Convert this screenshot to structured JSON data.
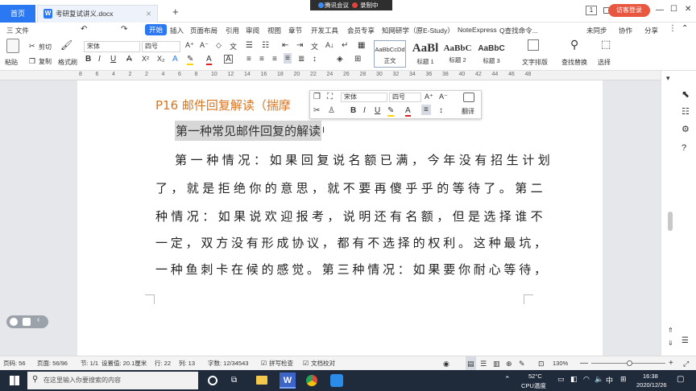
{
  "tabs": {
    "home": "首页",
    "doc_title": "考研复试讲义.docx",
    "add": "+"
  },
  "meeting": {
    "tencent": "腾讯会议",
    "recording": "录制中"
  },
  "window": {
    "page_indicator": "1",
    "login": "访客登录"
  },
  "menu": {
    "file": "三 文件",
    "items": [
      "开始",
      "插入",
      "页面布局",
      "引用",
      "审阅",
      "视图",
      "章节",
      "开发工具",
      "会员专享",
      "知网研学（原E-Study）",
      "NoteExpress",
      "Q查找命令..."
    ],
    "right": [
      "未同步",
      "协作",
      "分享"
    ]
  },
  "ribbon": {
    "paste": "粘贴",
    "cut": "剪切",
    "copy": "复制",
    "format_painter": "格式刷",
    "font": "宋体",
    "size": "四号",
    "styles": [
      {
        "preview": "AaBbCcDd",
        "name": "正文"
      },
      {
        "preview": "AaBl",
        "name": "标题 1"
      },
      {
        "preview": "AaBbC",
        "name": "标题 2"
      },
      {
        "preview": "AaBbC",
        "name": "标题 3"
      }
    ],
    "text_layout": "文字排版",
    "find_replace": "查找替换",
    "select": "选择"
  },
  "ruler": {
    "ticks": [
      "8",
      "6",
      "4",
      "2",
      "2",
      "4",
      "6",
      "8",
      "10",
      "12",
      "14",
      "16",
      "18",
      "20",
      "22",
      "24",
      "26",
      "28",
      "30",
      "32",
      "34",
      "36",
      "38",
      "40",
      "42",
      "44",
      "46",
      "48"
    ]
  },
  "mini_toolbar": {
    "font": "宋体",
    "size": "四号",
    "translate": "翻译"
  },
  "document": {
    "heading": "P16 邮件回复解读（揣摩",
    "subheading": "第一种常见邮件回复的解读",
    "lines": [
      "第一种情况：如果回复说名额已满，今年没有招生计划",
      "了，就是拒绝你的意思，就不要再傻乎乎的等待了。第二",
      "种情况：如果说欢迎报考，说明还有名额，但是选择谁不",
      "一定，双方没有形成协议，都有不选择的权利。这种最坑，",
      "一种鱼刺卡在候的感觉。第三种情况：如果要你耐心等待，"
    ]
  },
  "status": {
    "page_num": "页码: 56",
    "page": "页面: 56/96",
    "section": "节: 1/1",
    "setting": "设置值: 20.1厘米",
    "row": "行: 22",
    "col": "列: 13",
    "word_count": "字数: 12/34543",
    "spell": "拼写检查",
    "proof": "文档校对",
    "zoom": "130%"
  },
  "taskbar": {
    "search_placeholder": "在这里输入你要搜索的内容",
    "temp": "52°C",
    "cpu": "CPU温度",
    "lang": "中",
    "time": "16:38",
    "date": "2020/12/26"
  },
  "colors": {
    "accent": "#2b79f2",
    "heading": "#d9741f",
    "taskbar": "#1f2a3a",
    "login": "#e8573f"
  }
}
